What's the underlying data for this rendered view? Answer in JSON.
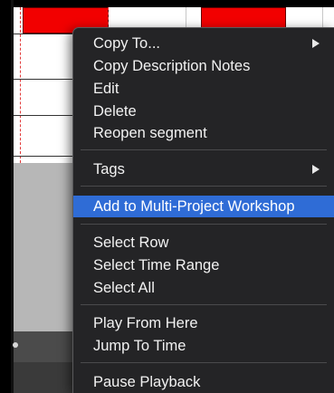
{
  "context_menu": {
    "items": {
      "copy_to": "Copy To...",
      "copy_description_notes": "Copy Description Notes",
      "edit": "Edit",
      "delete": "Delete",
      "reopen_segment": "Reopen segment",
      "tags": "Tags",
      "add_to_workshop": "Add to Multi-Project Workshop",
      "select_row": "Select Row",
      "select_time_range": "Select Time Range",
      "select_all": "Select All",
      "play_from_here": "Play From Here",
      "jump_to_time": "Jump To Time",
      "pause_playback": "Pause Playback"
    },
    "highlighted_item": "add_to_workshop",
    "submenu_icons": [
      "chevron-right-icon",
      "chevron-right-icon"
    ]
  },
  "colors": {
    "segment": "#f20000",
    "menu_bg": "#242426",
    "highlight": "#2f6cd6"
  }
}
